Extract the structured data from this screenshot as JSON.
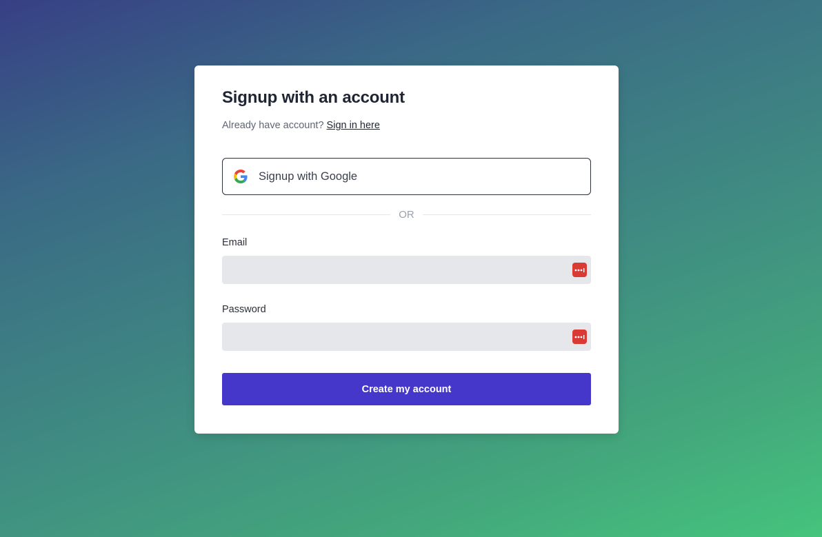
{
  "form": {
    "title": "Signup with an account",
    "subtitle_prefix": "Already have account?",
    "signin_link": "Sign in here",
    "google_button_label": "Signup with Google",
    "divider_text": "OR",
    "email": {
      "label": "Email",
      "value": "",
      "placeholder": ""
    },
    "password": {
      "label": "Password",
      "value": "",
      "placeholder": ""
    },
    "submit_label": "Create my account"
  },
  "icons": {
    "google": "google-icon",
    "password_manager": "password-manager-icon"
  },
  "colors": {
    "primary_button": "#4437c9",
    "password_manager_badge": "#d93a34",
    "background_gradient_start": "#373f85",
    "background_gradient_end": "#45c47c"
  }
}
